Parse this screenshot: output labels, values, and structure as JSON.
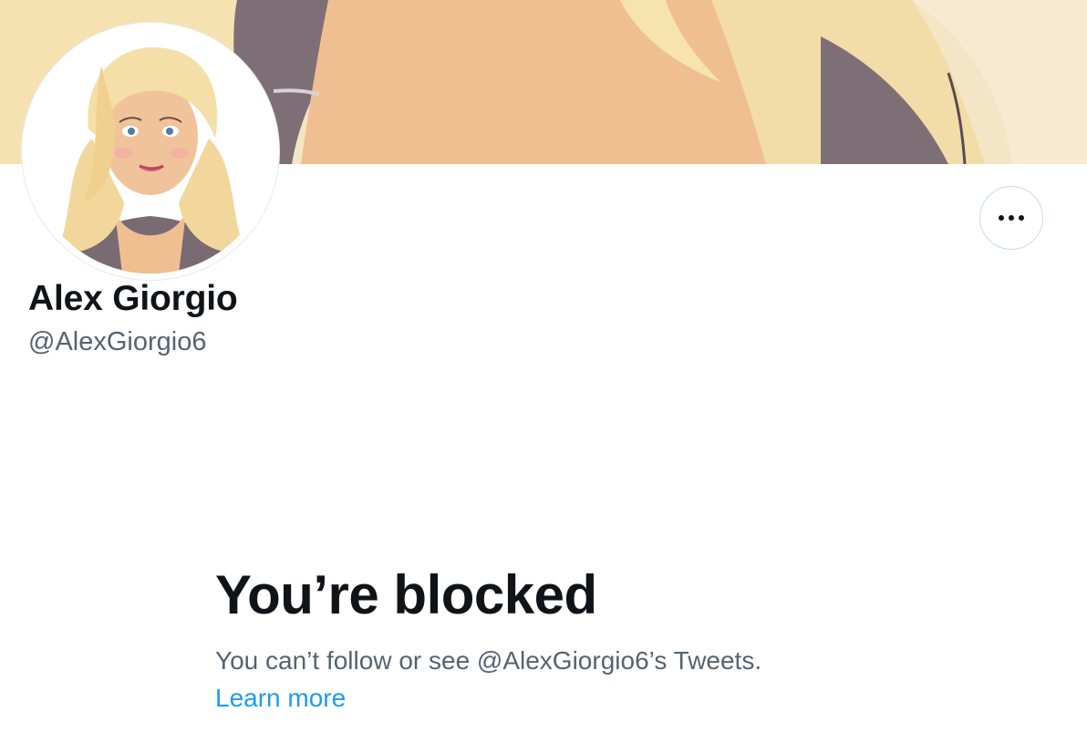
{
  "profile": {
    "display_name": "Alex Giorgio",
    "handle": "@AlexGiorgio6"
  },
  "actions": {
    "more_icon": "ellipsis-horizontal-icon"
  },
  "blocked": {
    "title": "You’re blocked",
    "description": "You can’t follow or see @AlexGiorgio6’s Tweets.",
    "link_label": "Learn more"
  },
  "colors": {
    "text_primary": "#0f1419",
    "text_secondary": "#536471",
    "link": "#1d9bf0",
    "border": "#cfd9de"
  }
}
